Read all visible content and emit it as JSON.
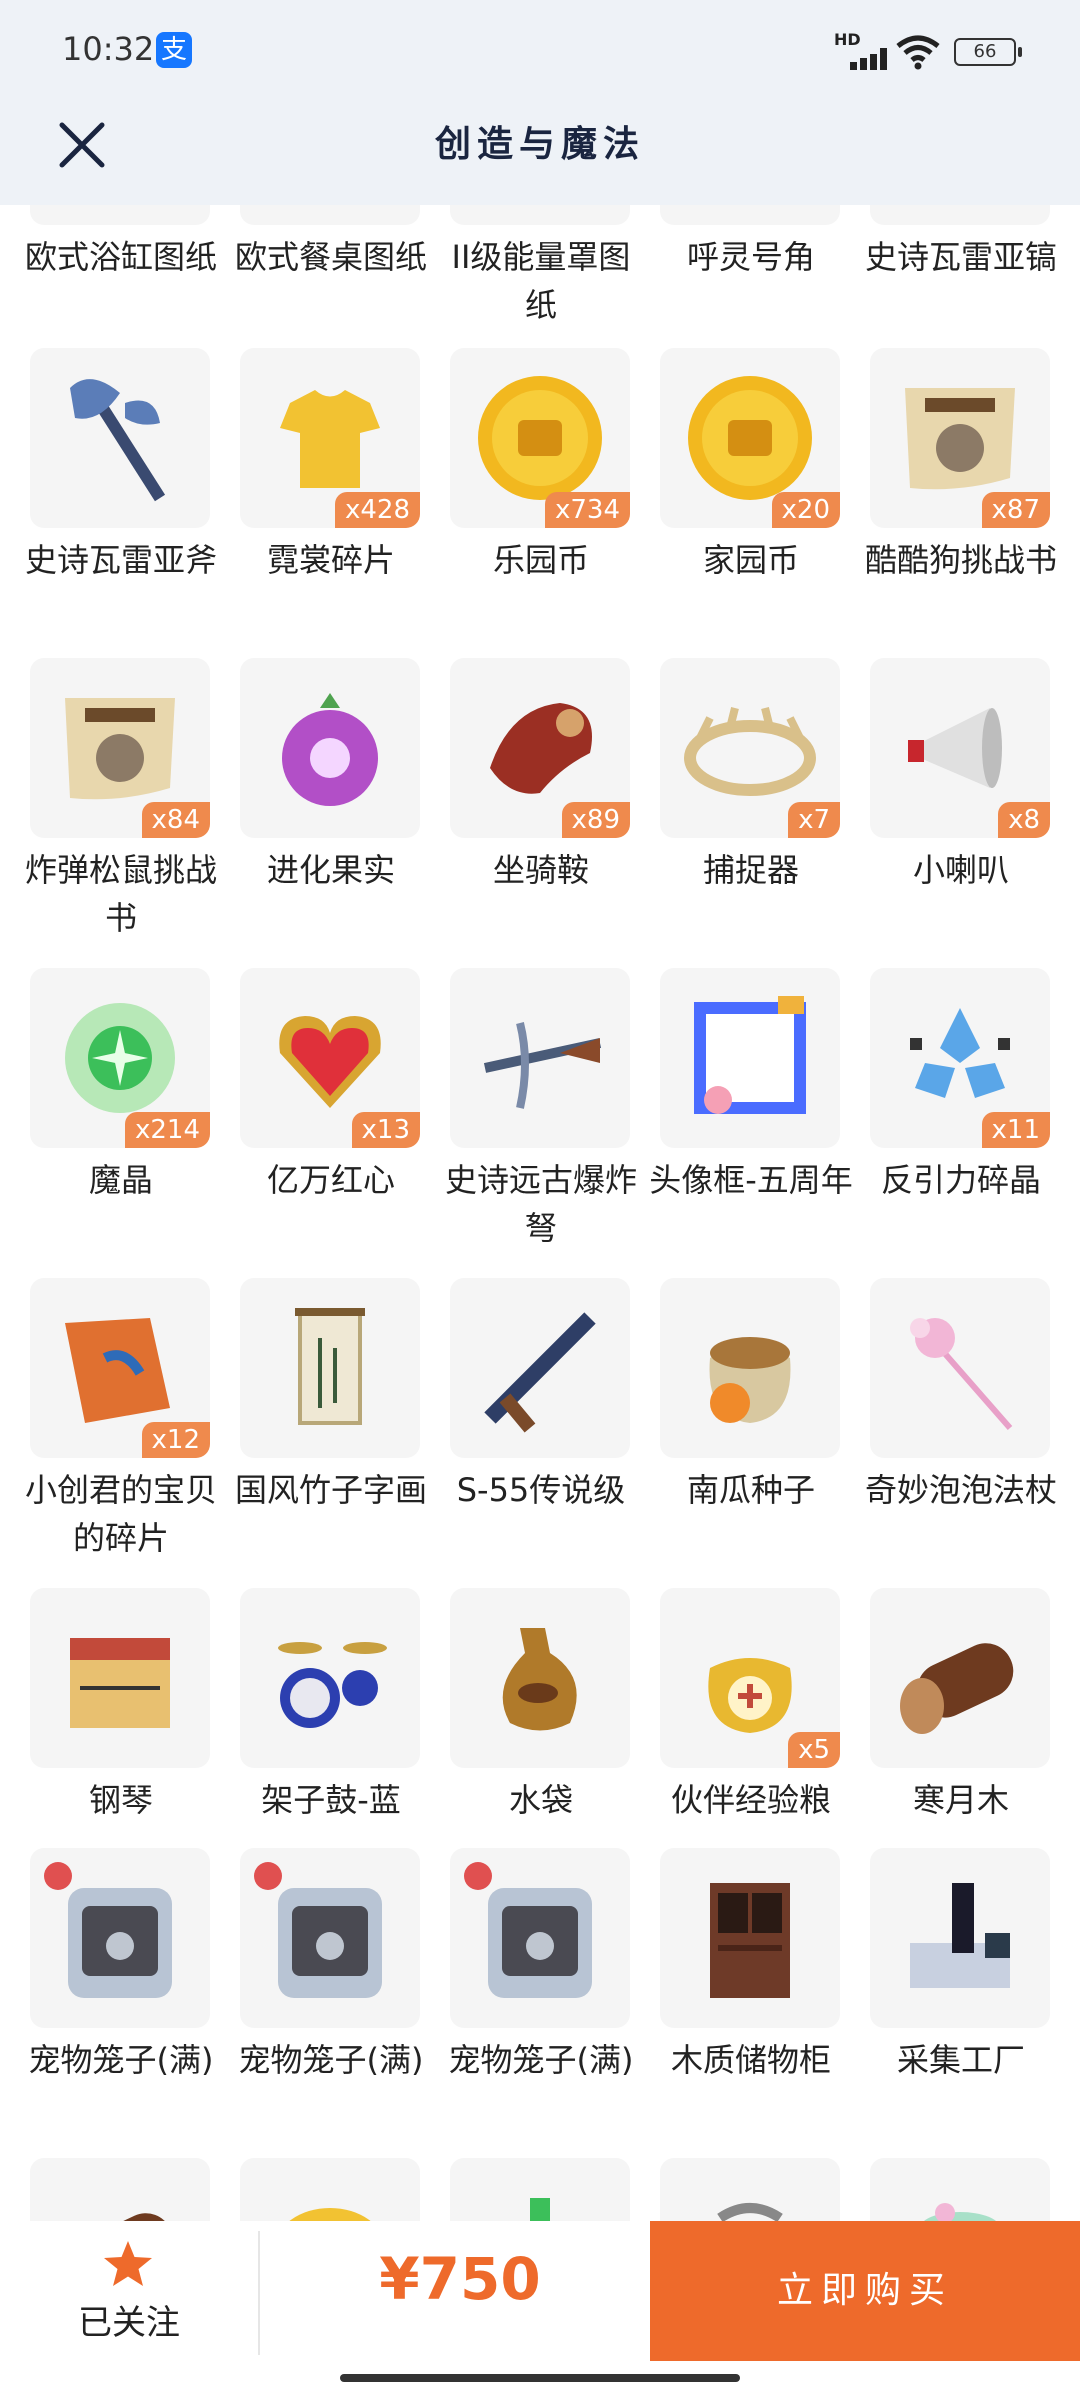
{
  "status_bar": {
    "time": "10:32",
    "alipay_glyph": "支",
    "network": "HD",
    "battery": "66"
  },
  "header": {
    "title": "创造与魔法"
  },
  "items": [
    {
      "label": "欧式浴缸图纸",
      "badge": "",
      "icon": "blueprint-icon"
    },
    {
      "label": "欧式餐桌图纸",
      "badge": "",
      "icon": "blueprint-icon"
    },
    {
      "label": "II级能量罩图纸",
      "badge": "",
      "icon": "blueprint-icon"
    },
    {
      "label": "呼灵号角",
      "badge": "",
      "icon": "horn-icon"
    },
    {
      "label": "史诗瓦雷亚镐",
      "badge": "",
      "icon": "pickaxe-icon"
    },
    {
      "label": "史诗瓦雷亚斧",
      "badge": "",
      "icon": "axe-icon"
    },
    {
      "label": "霓裳碎片",
      "badge": "x428",
      "icon": "shirt-icon"
    },
    {
      "label": "乐园币",
      "badge": "x734",
      "icon": "gold-coin-icon"
    },
    {
      "label": "家园币",
      "badge": "x20",
      "icon": "gold-coin-icon"
    },
    {
      "label": "酷酷狗挑战书",
      "badge": "x87",
      "icon": "wanted-poster-icon"
    },
    {
      "label": "炸弹松鼠挑战书",
      "badge": "x84",
      "icon": "wanted-poster-icon"
    },
    {
      "label": "进化果实",
      "badge": "",
      "icon": "fruit-icon"
    },
    {
      "label": "坐骑鞍",
      "badge": "x89",
      "icon": "saddle-icon"
    },
    {
      "label": "捕捉器",
      "badge": "x7",
      "icon": "trap-icon"
    },
    {
      "label": "小喇叭",
      "badge": "x8",
      "icon": "megaphone-icon"
    },
    {
      "label": "魔晶",
      "badge": "x214",
      "icon": "magic-crystal-icon"
    },
    {
      "label": "亿万红心",
      "badge": "x13",
      "icon": "heart-icon"
    },
    {
      "label": "史诗远古爆炸弩",
      "badge": "",
      "icon": "crossbow-icon"
    },
    {
      "label": "头像框-五周年",
      "badge": "",
      "icon": "avatar-frame-icon"
    },
    {
      "label": "反引力碎晶",
      "badge": "x11",
      "icon": "anti-gravity-crystal-icon"
    },
    {
      "label": "小创君的宝贝的碎片",
      "badge": "x12",
      "icon": "puzzle-piece-icon"
    },
    {
      "label": "国风竹子字画",
      "badge": "",
      "icon": "scroll-painting-icon"
    },
    {
      "label": "S-55传说级",
      "badge": "",
      "icon": "gun-icon"
    },
    {
      "label": "南瓜种子",
      "badge": "",
      "icon": "seed-bag-icon"
    },
    {
      "label": "奇妙泡泡法杖",
      "badge": "",
      "icon": "wand-icon"
    },
    {
      "label": "钢琴",
      "badge": "",
      "icon": "piano-icon"
    },
    {
      "label": "架子鼓-蓝",
      "badge": "",
      "icon": "drum-kit-icon"
    },
    {
      "label": "水袋",
      "badge": "",
      "icon": "water-bag-icon"
    },
    {
      "label": "伙伴经验粮",
      "badge": "x5",
      "icon": "food-bag-icon"
    },
    {
      "label": "寒月木",
      "badge": "",
      "icon": "log-icon"
    },
    {
      "label": "宠物笼子(满)",
      "badge": "",
      "icon": "pet-cage-icon"
    },
    {
      "label": "宠物笼子(满)",
      "badge": "",
      "icon": "pet-cage-icon"
    },
    {
      "label": "宠物笼子(满)",
      "badge": "",
      "icon": "pet-cage-icon"
    },
    {
      "label": "木质储物柜",
      "badge": "",
      "icon": "cabinet-icon"
    },
    {
      "label": "采集工厂",
      "badge": "",
      "icon": "factory-icon"
    },
    {
      "label": "",
      "badge": "",
      "icon": "log-icon"
    },
    {
      "label": "",
      "badge": "",
      "icon": "food-icon"
    },
    {
      "label": "",
      "badge": "",
      "icon": "bottle-icon"
    },
    {
      "label": "",
      "badge": "",
      "icon": "tool-icon"
    },
    {
      "label": "",
      "badge": "",
      "icon": "decoration-icon"
    }
  ],
  "bottom_bar": {
    "follow_label": "已关注",
    "price": "¥750",
    "buy_label": "立即购买"
  },
  "colors": {
    "accent": "#ee6a2b",
    "badge": "#ef8a4d",
    "header_bg": "#eef2f7"
  }
}
